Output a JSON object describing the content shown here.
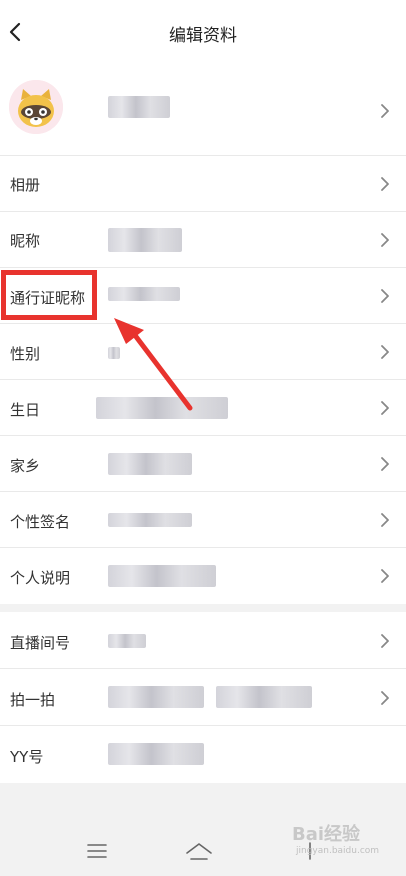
{
  "header": {
    "title": "编辑资料"
  },
  "rows": {
    "album": "相册",
    "nickname": "昵称",
    "passport_nickname": "通行证昵称",
    "gender": "性别",
    "birthday": "生日",
    "hometown": "家乡",
    "signature": "个性签名",
    "bio": "个人说明",
    "live_room": "直播间号",
    "pat": "拍一拍",
    "yy_id": "YY号"
  },
  "icons": {
    "back": "chevron-left-icon",
    "row_arrow": "chevron-right-icon",
    "menu": "menu-icon",
    "home": "home-icon",
    "back_nav": "back-nav-icon"
  },
  "watermark": {
    "brand": "Bai经验",
    "sub": "jingyan.baidu.com"
  },
  "colors": {
    "highlight": "#e8332e",
    "background": "#f2f2f2"
  }
}
